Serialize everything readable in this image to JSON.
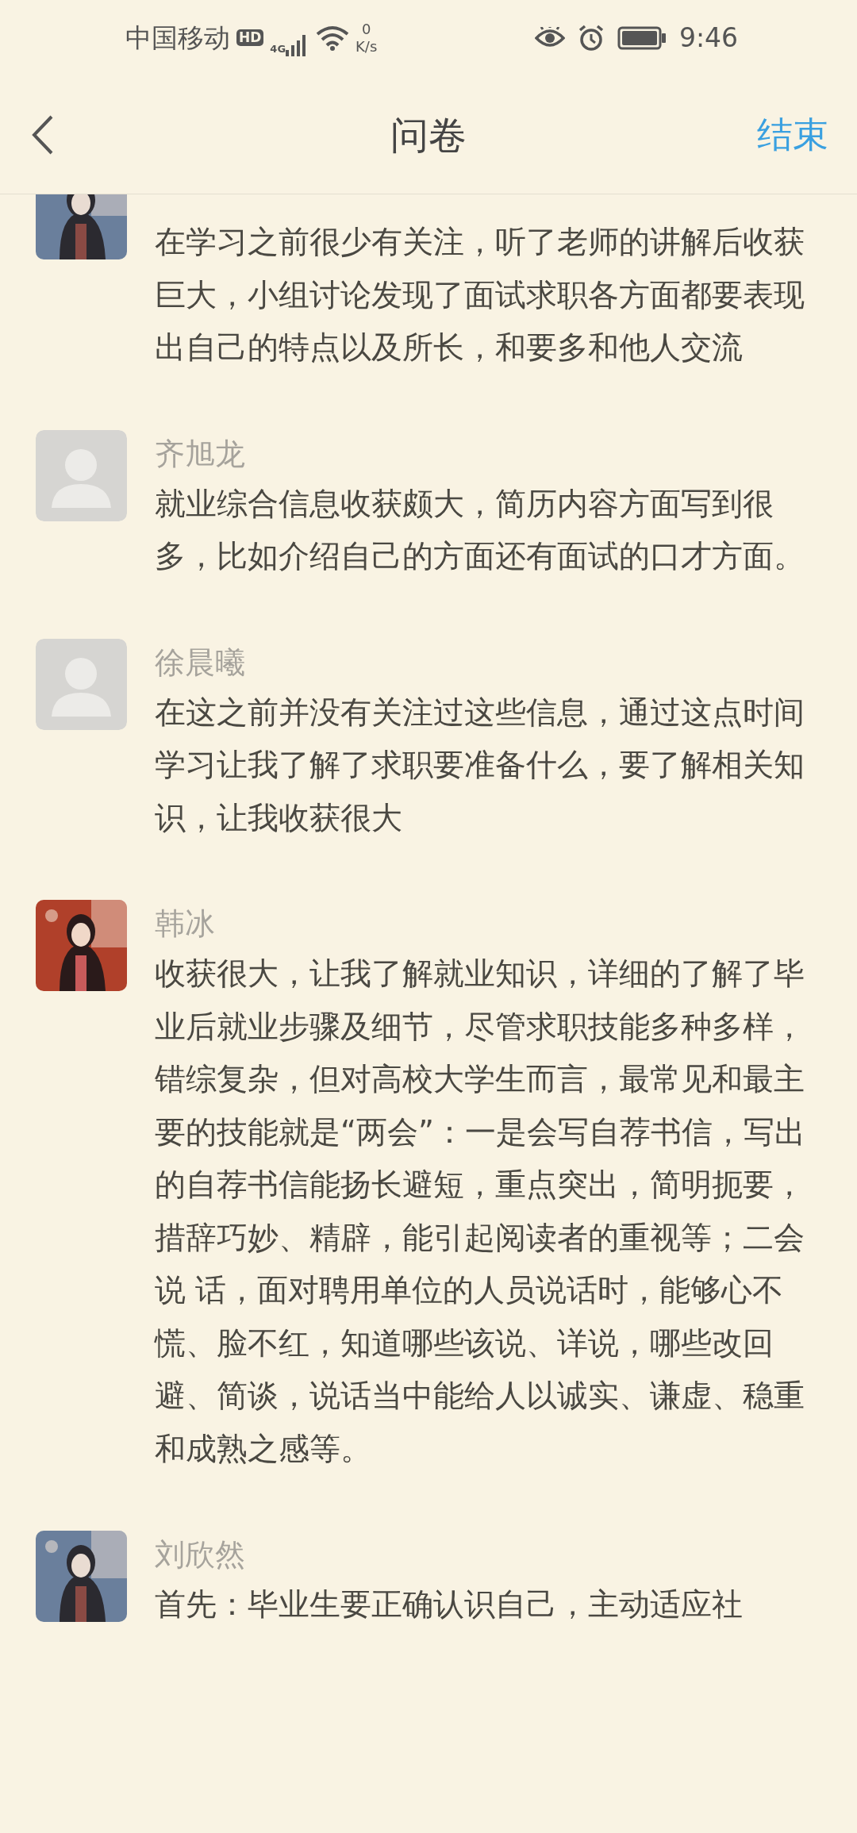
{
  "status_bar": {
    "carrier": "中国移动",
    "hd": "HD",
    "network": "4G",
    "speed": "0",
    "speed_unit": "K/s",
    "time": "9:46"
  },
  "header": {
    "title": "问卷",
    "action": "结束"
  },
  "comments": [
    {
      "text": "在学习之前很少有关注，听了老师的讲解后收获巨大，小组讨论发现了面试求职各方面都要表现出自己的特点以及所长，和要多和他人交流"
    },
    {
      "avatar": {
        "kind": "default"
      },
      "name": "齐旭龙",
      "text": "就业综合信息收获颇大，简历内容方面写到很多，比如介绍自己的方面还有面试的口才方面。"
    },
    {
      "avatar": {
        "kind": "default"
      },
      "name": "徐晨曦",
      "text": "在这之前并没有关注过这些信息，通过这点时间学习让我了解了求职要准备什么，要了解相关知识，让我收获很大"
    },
    {
      "avatar": {
        "kind": "illustration"
      },
      "name": "韩冰",
      "text": "收获很大，让我了解就业知识，详细的了解了毕业后就业步骤及细节，尽管求职技能多种多样，错综复杂，但对高校大学生而言，最常见和最主要的技能就是“两会”：一是会写自荐书信，写出的自荐书信能扬长避短，重点突出，简明扼要，措辞巧妙、精辟，能引起阅读者的重视等；二会说  话，面对聘用单位的人员说话时，能够心不慌、脸不红，知道哪些该说、详说，哪些改回避、简谈，说话当中能给人以诚实、谦虚、稳重和成熟之感等。"
    },
    {
      "name": "刘欣然",
      "text": "首先：毕业生要正确认识自己，主动适应社"
    }
  ]
}
